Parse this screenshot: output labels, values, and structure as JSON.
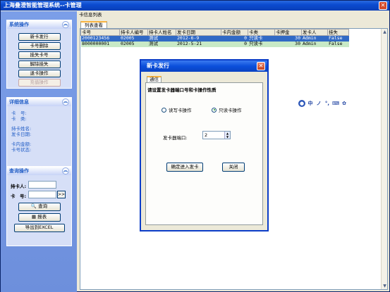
{
  "window": {
    "title": "上海叠澄智能管理系统--卡管理"
  },
  "sidebar": {
    "system_ops": {
      "header": "系统操作",
      "buttons": [
        "新卡发行",
        "卡号删除",
        "挂失卡号",
        "解除挂失",
        "退卡操作",
        "充值操作"
      ]
    },
    "details": {
      "header": "详细信息",
      "lines": [
        "卡　号:",
        "卡　类:",
        "持卡姓名:",
        "发卡日期:",
        "卡内金额:",
        "卡号状态:"
      ]
    },
    "query": {
      "header": "查询操作",
      "holder_label": "持卡人:",
      "card_label": "卡　号:",
      "mini_btn": ">>",
      "query_btn": "查询",
      "report_btn": "报表",
      "export_btn": "导出到EXCEL"
    }
  },
  "main": {
    "section_title": "卡信息列表",
    "tab_label": "列表查看",
    "table": {
      "columns": [
        "卡号",
        "持卡人编号",
        "持卡人姓名",
        "发卡日期",
        "卡内金额",
        "卡类",
        "卡押金",
        "发卡人",
        "挂失"
      ],
      "rows": [
        [
          "2000123456",
          "02005",
          "测试",
          "2012-6-9",
          "0",
          "只读卡",
          "30",
          "Admin",
          "False"
        ],
        [
          "8000000001",
          "02005",
          "测试",
          "2012-5-21",
          "0",
          "只读卡",
          "30",
          "Admin",
          "False"
        ]
      ]
    }
  },
  "ime": {
    "items": [
      "中",
      "ノ",
      "°,",
      "⌨",
      "✿"
    ]
  },
  "dialog": {
    "title": "新卡发行",
    "tab": "通信",
    "hint": "请设置发卡器端口号和卡操作性质",
    "radio_rw": "读写卡操作",
    "radio_ro": "只读卡操作",
    "selected": "只读卡操作",
    "port_label": "发卡器端口:",
    "port_value": "2",
    "confirm_btn": "确定进入发卡",
    "close_btn": "关闭"
  },
  "colors": {
    "title_blue": "#0b4bd0",
    "selection": "#316ac5",
    "alt_row": "#c8e9c6",
    "side_bg": "#6d8fdc"
  }
}
